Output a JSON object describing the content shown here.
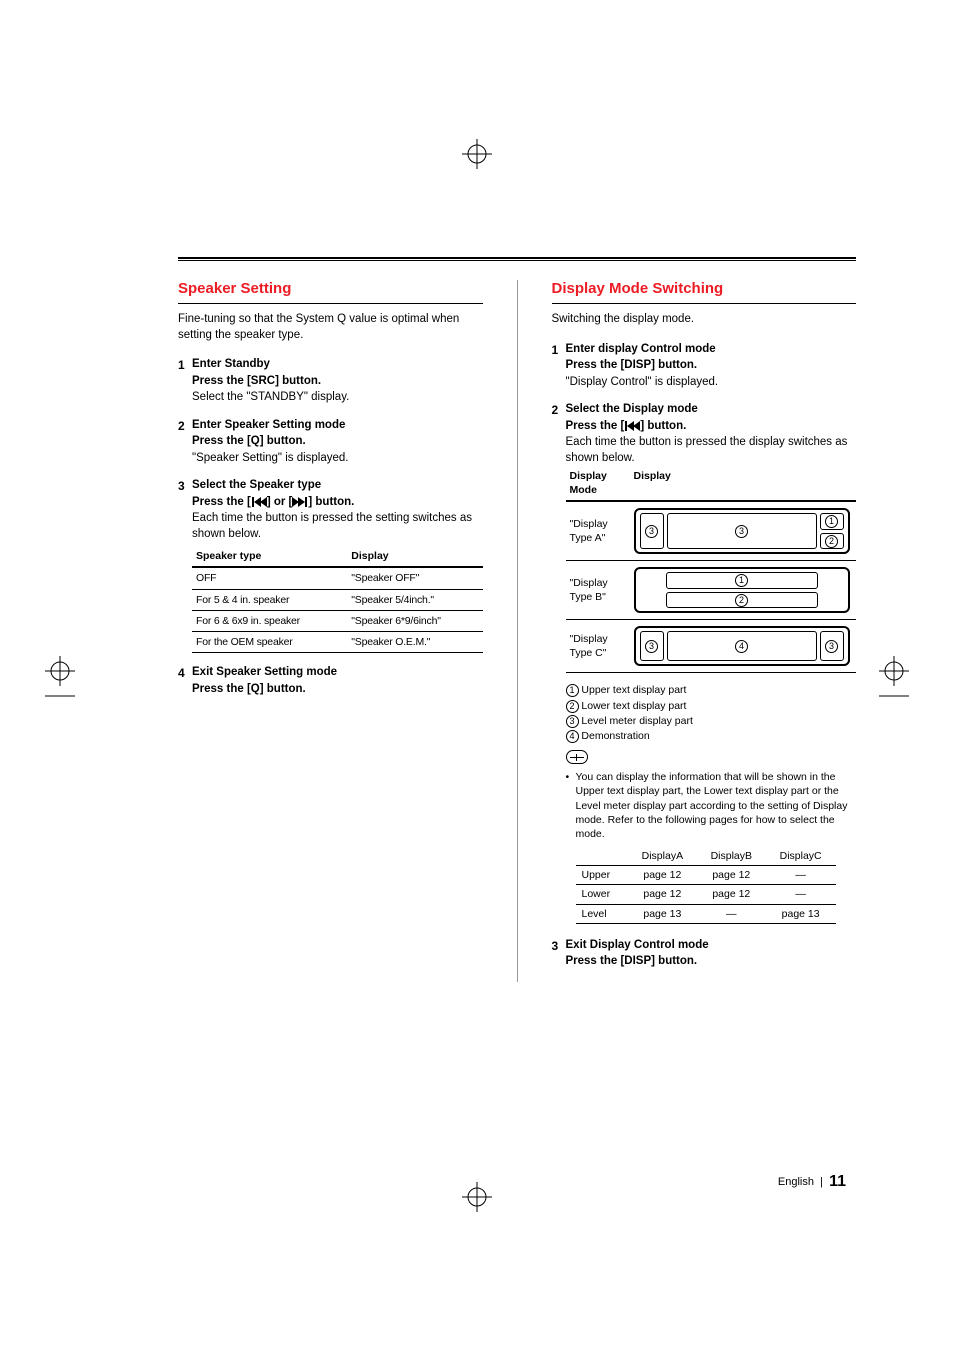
{
  "left": {
    "title": "Speaker Setting",
    "intro": "Fine-tuning so that the System Q value is optimal when setting the speaker type.",
    "steps": [
      {
        "num": "1",
        "title": "Enter Standby",
        "lines": [
          {
            "bold": true,
            "text": "Press the [SRC] button."
          },
          {
            "bold": false,
            "text": "Select the \"STANDBY\" display."
          }
        ]
      },
      {
        "num": "2",
        "title": "Enter Speaker Setting mode",
        "lines": [
          {
            "bold": true,
            "text": "Press the [Q] button."
          },
          {
            "bold": false,
            "text": "\"Speaker Setting\" is displayed."
          }
        ]
      },
      {
        "num": "3",
        "title": "Select the Speaker type",
        "press_prefix": "Press the [",
        "press_mid": "] or [",
        "press_suffix": "] button.",
        "lines_after": [
          "Each time the button is pressed the setting switches as shown below."
        ],
        "table": {
          "headers": [
            "Speaker type",
            "Display"
          ],
          "rows": [
            [
              "OFF",
              "\"Speaker OFF\""
            ],
            [
              "For 5 & 4 in. speaker",
              "\"Speaker 5/4inch.\""
            ],
            [
              "For 6 & 6x9 in. speaker",
              "\"Speaker 6*9/6inch\""
            ],
            [
              "For the OEM speaker",
              "\"Speaker O.E.M.\""
            ]
          ]
        }
      },
      {
        "num": "4",
        "title": "Exit Speaker Setting mode",
        "lines": [
          {
            "bold": true,
            "text": "Press the [Q] button."
          }
        ]
      }
    ]
  },
  "right": {
    "title": "Display Mode Switching",
    "intro": "Switching the display mode.",
    "steps": [
      {
        "num": "1",
        "title": "Enter display Control mode",
        "lines": [
          {
            "bold": true,
            "text": "Press the [DISP] button."
          },
          {
            "bold": false,
            "text": "\"Display Control\" is displayed."
          }
        ]
      },
      {
        "num": "2",
        "title": "Select the Display mode",
        "press_prefix": "Press the [",
        "press_suffix": "] button.",
        "lines_after": [
          "Each time the button is pressed the display switches as shown below."
        ],
        "disptable": {
          "headers": [
            "Display Mode",
            "Display"
          ],
          "rows": [
            {
              "mode": "\"Display Type A\"",
              "layout": "A",
              "cells": [
                "3",
                "1",
                "3",
                "2"
              ]
            },
            {
              "mode": "\"Display Type B\"",
              "layout": "B",
              "cells": [
                "1",
                "2"
              ]
            },
            {
              "mode": "\"Display Type C\"",
              "layout": "C",
              "cells": [
                "3",
                "4",
                "3"
              ]
            }
          ]
        },
        "legend": [
          {
            "n": "1",
            "text": "Upper text display part"
          },
          {
            "n": "2",
            "text": "Lower text display part"
          },
          {
            "n": "3",
            "text": "Level meter display part"
          },
          {
            "n": "4",
            "text": "Demonstration"
          }
        ],
        "note_bullet": "You can display the information that will be shown in the Upper text display part, the Lower text display part or the Level meter display part according to the setting of Display mode. Refer to the following pages for how to select the mode.",
        "pageref": {
          "headers": [
            "",
            "DisplayA",
            "DisplayB",
            "DisplayC"
          ],
          "rows": [
            [
              "Upper",
              "page 12",
              "page 12",
              "—"
            ],
            [
              "Lower",
              "page 12",
              "page 12",
              "—"
            ],
            [
              "Level",
              "page 13",
              "—",
              "page 13"
            ]
          ]
        }
      },
      {
        "num": "3",
        "title": "Exit Display Control mode",
        "lines": [
          {
            "bold": true,
            "text": "Press the [DISP] button."
          }
        ]
      }
    ]
  },
  "footer": {
    "lang": "English",
    "sep": "|",
    "page": "11"
  }
}
